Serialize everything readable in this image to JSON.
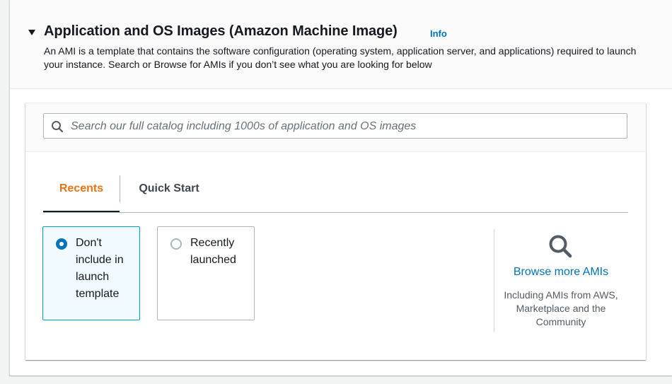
{
  "section": {
    "title": "Application and OS Images (Amazon Machine Image)",
    "info_label": "Info",
    "description": "An AMI is a template that contains the software configuration (operating system, application server, and applications) required to launch your instance. Search or Browse for AMIs if you don’t see what you are looking for below"
  },
  "search": {
    "placeholder": "Search our full catalog including 1000s of application and OS images",
    "value": "",
    "icon": "search-icon"
  },
  "tabs": [
    {
      "label": "Recents",
      "active": true
    },
    {
      "label": "Quick Start",
      "active": false
    }
  ],
  "options": [
    {
      "label": "Don't include in launch template",
      "selected": true
    },
    {
      "label": "Recently launched",
      "selected": false
    }
  ],
  "browse": {
    "icon": "magnifier-icon",
    "link_label": "Browse more AMIs",
    "subtext": "Including AMIs from AWS, Marketplace and the Community"
  },
  "colors": {
    "link": "#0073bb",
    "active_tab": "#ec7211",
    "selected_tile_bg": "#f1faff",
    "selected_tile_border": "#00a1c9"
  }
}
